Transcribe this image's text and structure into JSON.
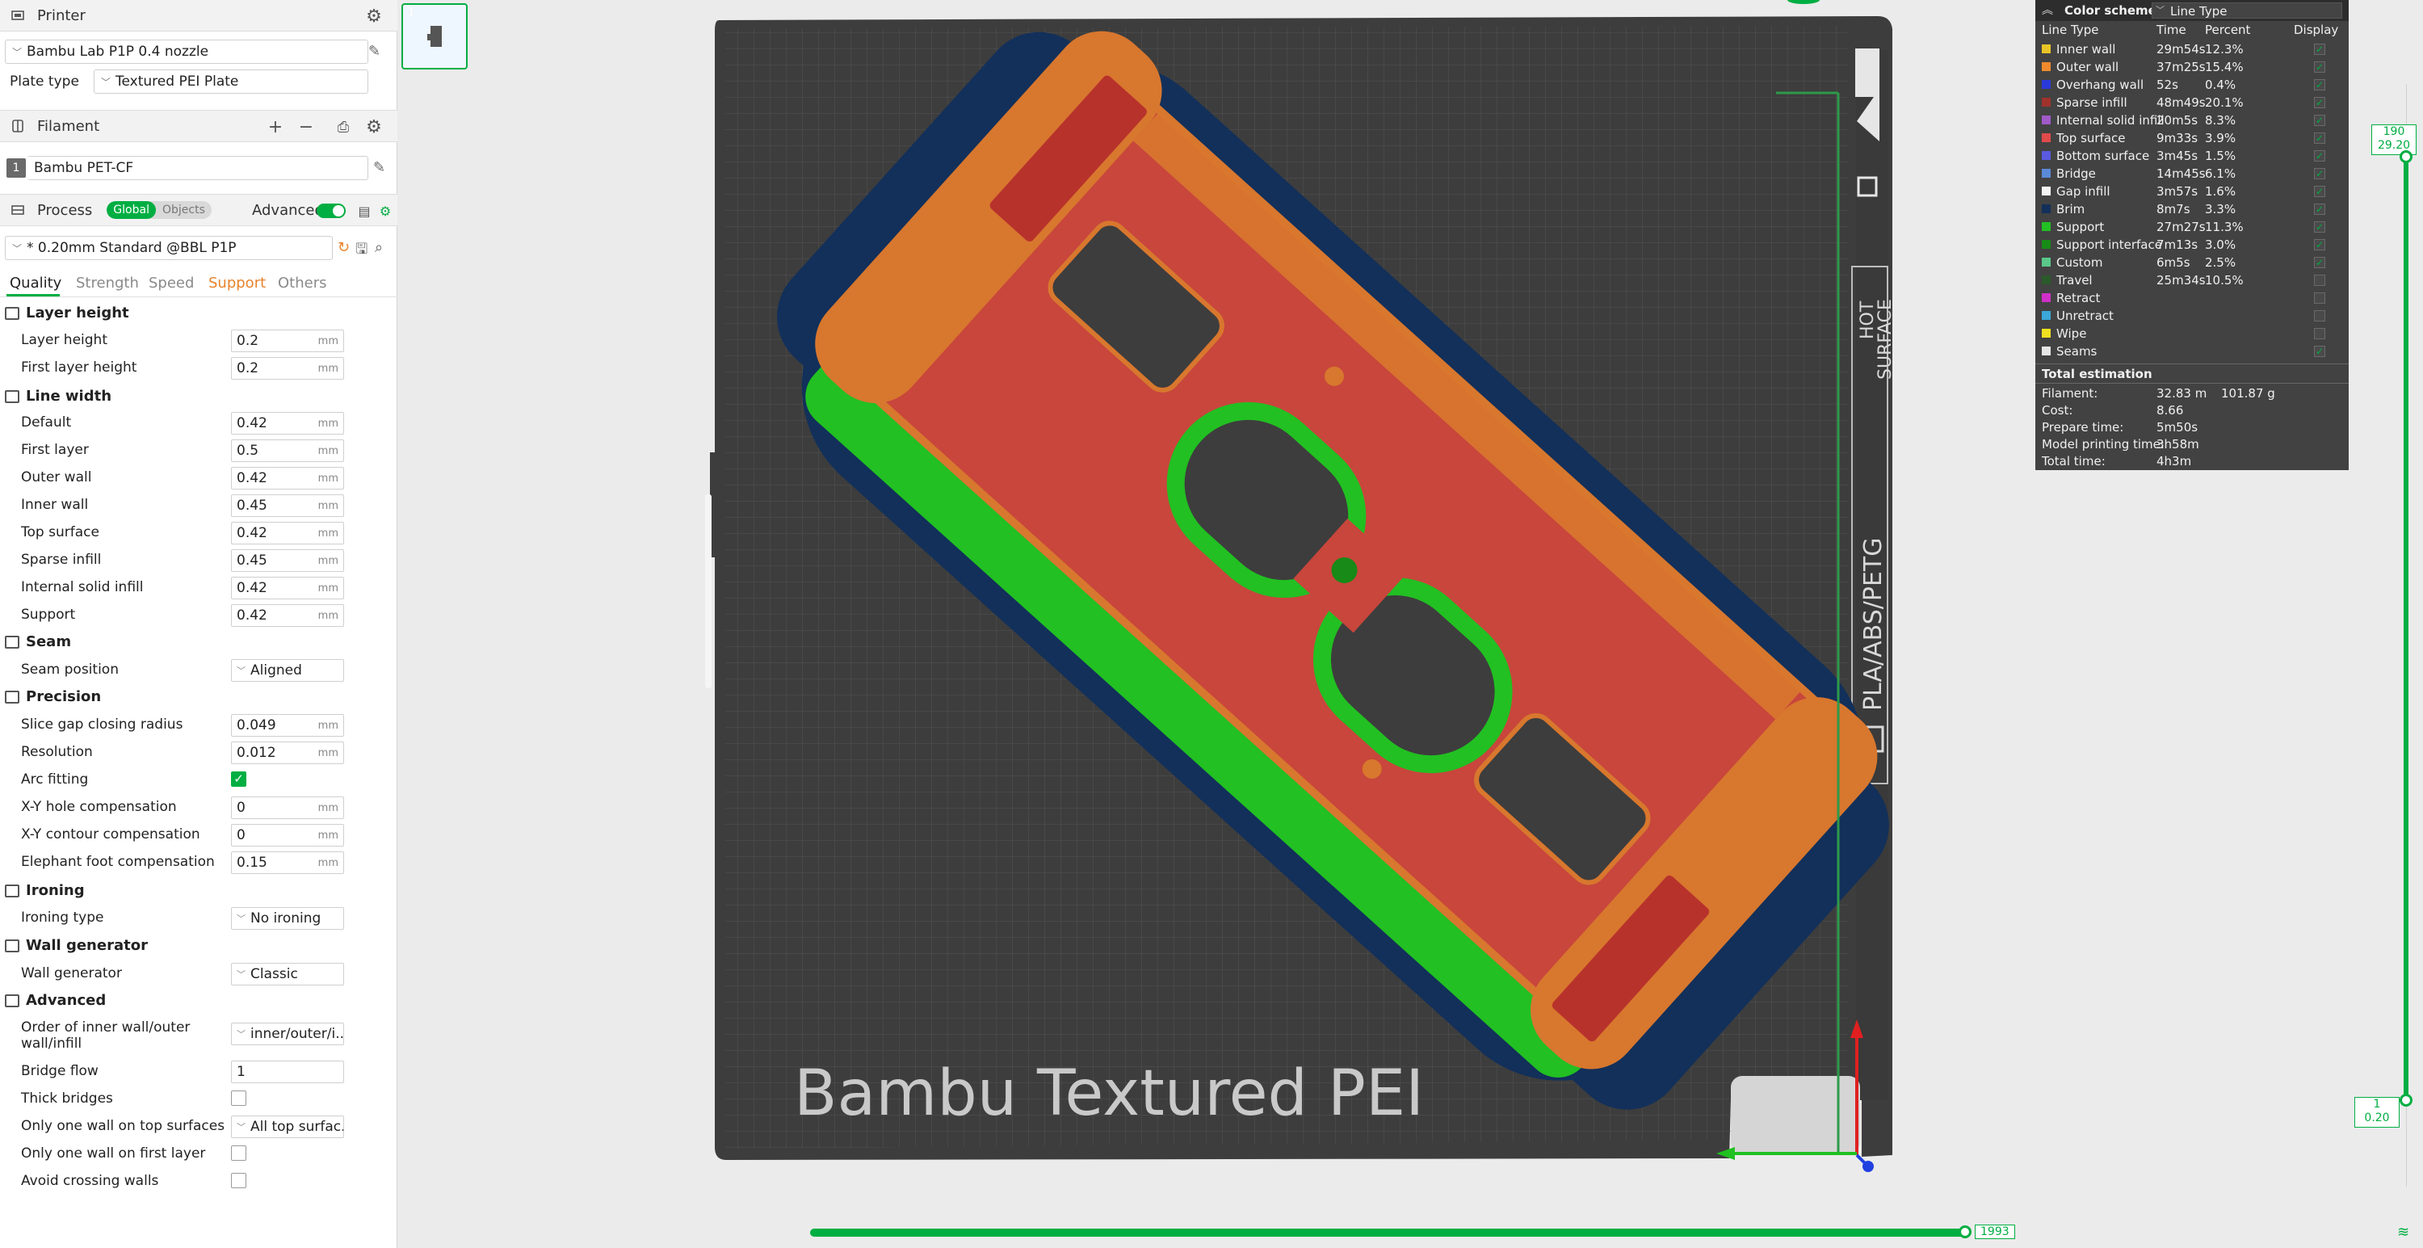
{
  "printer": {
    "header": "Printer",
    "name": "Bambu Lab P1P 0.4 nozzle",
    "plate_type_label": "Plate type",
    "plate_type": "Textured PEI Plate"
  },
  "filament": {
    "header": "Filament",
    "slot": "1",
    "name": "Bambu PET-CF"
  },
  "process": {
    "header": "Process",
    "toggle_global": "Global",
    "toggle_objects": "Objects",
    "advanced_label": "Advanced",
    "preset": "* 0.20mm Standard @BBL P1P"
  },
  "tabs": [
    "Quality",
    "Strength",
    "Speed",
    "Support",
    "Others"
  ],
  "settings": {
    "layer_height_group": "Layer height",
    "layer_height_label": "Layer height",
    "layer_height": "0.2",
    "first_layer_height_label": "First layer height",
    "first_layer_height": "0.2",
    "line_width_group": "Line width",
    "lw_default_label": "Default",
    "lw_default": "0.42",
    "lw_first_layer_label": "First layer",
    "lw_first_layer": "0.5",
    "lw_outer_wall_label": "Outer wall",
    "lw_outer_wall": "0.42",
    "lw_inner_wall_label": "Inner wall",
    "lw_inner_wall": "0.45",
    "lw_top_surface_label": "Top surface",
    "lw_top_surface": "0.42",
    "lw_sparse_infill_label": "Sparse infill",
    "lw_sparse_infill": "0.45",
    "lw_internal_solid_infill_label": "Internal solid infill",
    "lw_internal_solid_infill": "0.42",
    "lw_support_label": "Support",
    "lw_support": "0.42",
    "seam_group": "Seam",
    "seam_position_label": "Seam position",
    "seam_position": "Aligned",
    "precision_group": "Precision",
    "slice_gap_label": "Slice gap closing radius",
    "slice_gap": "0.049",
    "resolution_label": "Resolution",
    "resolution": "0.012",
    "arc_fitting_label": "Arc fitting",
    "xy_hole_label": "X-Y hole compensation",
    "xy_hole": "0",
    "xy_contour_label": "X-Y contour compensation",
    "xy_contour": "0",
    "elephant_label": "Elephant foot compensation",
    "elephant": "0.15",
    "ironing_group": "Ironing",
    "ironing_type_label": "Ironing type",
    "ironing_type": "No ironing",
    "wall_gen_group": "Wall generator",
    "wall_gen_label": "Wall generator",
    "wall_gen": "Classic",
    "advanced_group": "Advanced",
    "wall_order_label_1": "Order of inner wall/outer",
    "wall_order_label_2": "wall/infill",
    "wall_order": "inner/outer/i...",
    "bridge_flow_label": "Bridge flow",
    "bridge_flow": "1",
    "thick_bridges_label": "Thick bridges",
    "one_wall_top_label": "Only one wall on top surfaces",
    "one_wall_top": "All top surfac...",
    "one_wall_first_label": "Only one wall on first layer",
    "avoid_crossing_label": "Avoid crossing walls",
    "unit": "mm"
  },
  "plate": {
    "thumb_index": "1",
    "bed_text": "Bambu Textured PEI",
    "side_text_1": "HOT",
    "side_text_2": "SURFACE",
    "side_text_3": "PLA/ABS/PETG"
  },
  "legend": {
    "header": "Color scheme",
    "scheme": "Line Type",
    "col_type": "Line Type",
    "col_time": "Time",
    "col_percent": "Percent",
    "col_display": "Display",
    "rows": [
      {
        "name": "Inner wall",
        "time": "29m54s",
        "pct": "12.3%",
        "color": "#e8c427",
        "on": true
      },
      {
        "name": "Outer wall",
        "time": "37m25s",
        "pct": "15.4%",
        "color": "#f08a2c",
        "on": true
      },
      {
        "name": "Overhang wall",
        "time": "52s",
        "pct": "0.4%",
        "color": "#2a3ad8",
        "on": true
      },
      {
        "name": "Sparse infill",
        "time": "48m49s",
        "pct": "20.1%",
        "color": "#a0322c",
        "on": true
      },
      {
        "name": "Internal solid infill",
        "time": "20m5s",
        "pct": "8.3%",
        "color": "#a05ac8",
        "on": true
      },
      {
        "name": "Top surface",
        "time": "9m33s",
        "pct": "3.9%",
        "color": "#e04a4a",
        "on": true
      },
      {
        "name": "Bottom surface",
        "time": "3m45s",
        "pct": "1.5%",
        "color": "#5a5ae0",
        "on": true
      },
      {
        "name": "Bridge",
        "time": "14m45s",
        "pct": "6.1%",
        "color": "#5a8ad8",
        "on": true
      },
      {
        "name": "Gap infill",
        "time": "3m57s",
        "pct": "1.6%",
        "color": "#f2f2f2",
        "on": true
      },
      {
        "name": "Brim",
        "time": "8m7s",
        "pct": "3.3%",
        "color": "#12305a",
        "on": true
      },
      {
        "name": "Support",
        "time": "27m27s",
        "pct": "11.3%",
        "color": "#22c022",
        "on": true
      },
      {
        "name": "Support interface",
        "time": "7m13s",
        "pct": "3.0%",
        "color": "#178a17",
        "on": true
      },
      {
        "name": "Custom",
        "time": "6m5s",
        "pct": "2.5%",
        "color": "#5ac88a",
        "on": true
      },
      {
        "name": "Travel",
        "time": "25m34s",
        "pct": "10.5%",
        "color": "#2a5a2a",
        "on": false
      },
      {
        "name": "Retract",
        "time": "",
        "pct": "",
        "color": "#d030c8",
        "on": false
      },
      {
        "name": "Unretract",
        "time": "",
        "pct": "",
        "color": "#3aa8d8",
        "on": false
      },
      {
        "name": "Wipe",
        "time": "",
        "pct": "",
        "color": "#f0e020",
        "on": false
      },
      {
        "name": "Seams",
        "time": "",
        "pct": "",
        "color": "#e6e6e6",
        "on": true
      }
    ],
    "total_title": "Total estimation",
    "totals": [
      {
        "label": "Filament:",
        "v1": "32.83 m",
        "v2": "101.87 g"
      },
      {
        "label": "Cost:",
        "v1": "8.66",
        "v2": ""
      },
      {
        "label": "Prepare time:",
        "v1": "5m50s",
        "v2": ""
      },
      {
        "label": "Model printing time:",
        "v1": "3h58m",
        "v2": ""
      },
      {
        "label": "Total time:",
        "v1": "4h3m",
        "v2": ""
      }
    ]
  },
  "layer_slider": {
    "top_layer": "190",
    "top_height": "29.20",
    "bottom_layer": "1",
    "bottom_height": "0.20"
  },
  "move_slider": {
    "value": "1993"
  },
  "colors": {
    "accent": "#00ae42",
    "bed": "#3d3d3d",
    "brim": "#12305a",
    "support": "#22c022",
    "top_surface": "#c8463c",
    "outer_wall": "#d8772e"
  }
}
